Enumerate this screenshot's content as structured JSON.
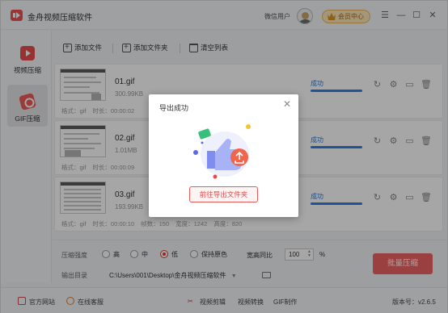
{
  "window": {
    "title": "金舟视频压缩软件"
  },
  "titlebar": {
    "user_name": "微信用户",
    "member_label": "会员中心"
  },
  "sidebar": {
    "items": [
      {
        "label": "视频压缩",
        "icon": "video-icon",
        "active": false
      },
      {
        "label": "GIF压缩",
        "icon": "gif-icon",
        "active": true
      }
    ]
  },
  "toolbar": {
    "add_file": "添加文件",
    "add_folder": "添加文件夹",
    "clear_list": "清空列表"
  },
  "files": [
    {
      "name": "01.gif",
      "size": "300.99KB",
      "format": "格式：gif",
      "duration": "时长：00:00:02",
      "status": "成功",
      "progress": 1.0
    },
    {
      "name": "02.gif",
      "size": "1.01MB",
      "format": "格式：gif",
      "duration": "时长：00:00:09",
      "status": "成功",
      "progress": 1.0
    },
    {
      "name": "03.gif",
      "size": "193.99KB",
      "format": "格式：gif",
      "duration": "时长：00:00:10",
      "frames": "帧数：150",
      "width": "宽度：1242",
      "height": "高度：820",
      "status": "成功",
      "progress": 1.0
    }
  ],
  "settings": {
    "strength_label": "压缩强度",
    "options": [
      "高",
      "中",
      "低",
      "保持原色"
    ],
    "selected": "低",
    "ratio_label": "宽高同比",
    "ratio_value": "100",
    "ratio_unit": "%",
    "output_label": "输出目录",
    "output_path": "C:\\Users\\001\\Desktop\\金舟视频压缩软件",
    "batch_button": "批量压缩"
  },
  "footer": {
    "website": "官方网站",
    "support": "在线客服",
    "links": [
      "视频剪辑",
      "视频转换",
      "GIF制作"
    ],
    "version": "版本号：v2.6.5"
  },
  "dialog": {
    "title": "导出成功",
    "button": "前往导出文件夹"
  },
  "colors": {
    "accent": "#ef6363",
    "success": "#2a7ad8",
    "progress": "#2f80ed"
  }
}
